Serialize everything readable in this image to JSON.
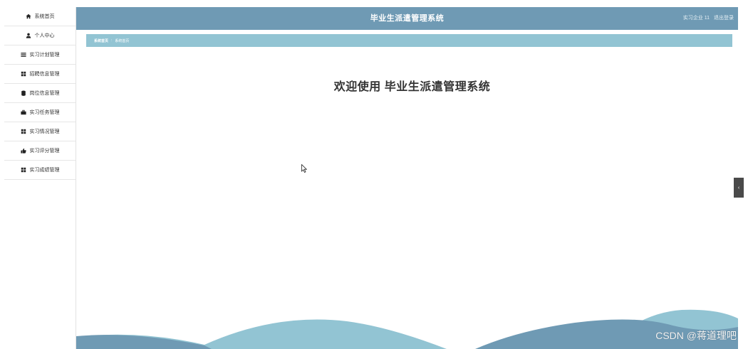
{
  "sidebar": {
    "items": [
      {
        "label": "系统首页",
        "icon": "home-icon"
      },
      {
        "label": "个人中心",
        "icon": "user-icon"
      },
      {
        "label": "实习计划管理",
        "icon": "list-icon"
      },
      {
        "label": "招聘信息管理",
        "icon": "grid-icon"
      },
      {
        "label": "岗位信息管理",
        "icon": "database-icon"
      },
      {
        "label": "实习任务管理",
        "icon": "briefcase-icon"
      },
      {
        "label": "实习情况管理",
        "icon": "grid-icon"
      },
      {
        "label": "实习评分管理",
        "icon": "thumbs-up-icon"
      },
      {
        "label": "实习成绩管理",
        "icon": "grid-icon"
      }
    ]
  },
  "header": {
    "title": "毕业生派遣管理系统",
    "user_label": "实习企业 11",
    "logout_label": "退出登录"
  },
  "breadcrumb": {
    "items": [
      "系统首页",
      "系统首页"
    ],
    "separator": ":"
  },
  "main": {
    "welcome_text": "欢迎使用 毕业生派遣管理系统"
  },
  "collapse_tab": {
    "label": "‹"
  },
  "watermark": "CSDN @蒋道理吧",
  "colors": {
    "header_bg": "#6f9ab4",
    "breadcrumb_bg": "#92c4d3",
    "wave_light": "#92c4d3",
    "wave_dark": "#6f9ab4"
  }
}
